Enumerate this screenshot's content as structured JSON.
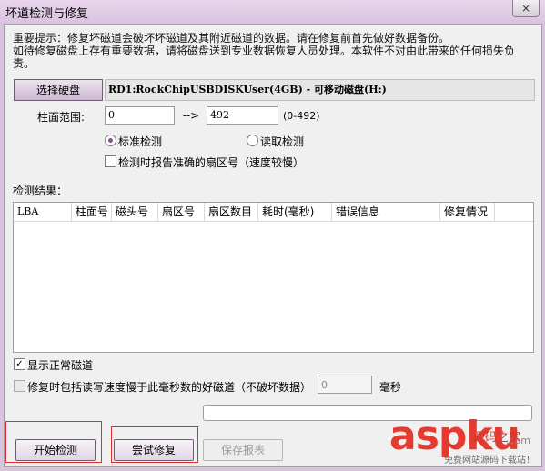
{
  "window": {
    "title": "坏道检测与修复",
    "close_label": "×"
  },
  "notice": {
    "line1": "重要提示：修复坏磁道会破坏坏磁道及其附近磁道的数据。请在修复前首先做好数据备份。",
    "line2": "如待修复磁盘上存有重要数据，请将磁盘送到专业数据恢复人员处理。本软件不对由此带来的任何损失负责。"
  },
  "disk": {
    "select_label": "选择硬盘",
    "name": "RD1:RockChipUSBDISKUser(4GB) - 可移动磁盘(H:)"
  },
  "cylinder": {
    "label": "柱面范围:",
    "start": "0",
    "arrow": "-->",
    "end": "492",
    "range_hint": "(0-492)"
  },
  "mode": {
    "standard": "标准检测",
    "read": "读取检测",
    "selected": "standard"
  },
  "report_sector": {
    "label": "检测时报告准确的扇区号（速度较慢）",
    "checked": false
  },
  "results": {
    "label": "检测结果：",
    "columns": [
      "LBA",
      "柱面号",
      "磁头号",
      "扇区号",
      "扇区数目",
      "耗时(毫秒)",
      "错误信息",
      "修复情况"
    ],
    "rows": []
  },
  "show_normal": {
    "label": "显示正常磁道",
    "checked": true
  },
  "repair_slow": {
    "label": "修复时包括读写速度慢于此毫秒数的好磁道（不破坏数据）",
    "checked": false,
    "value": "0",
    "unit": "毫秒"
  },
  "progress": {
    "value": 0
  },
  "buttons": {
    "start": "开始检测",
    "repair": "尝试修复",
    "save": "保存报表"
  },
  "watermark": {
    "brand": "aspku",
    "com": ".com",
    "sub": "源码之家",
    "foot": "免费网站源码下载站！"
  },
  "colors": {
    "accent": "#8f4f96",
    "highlight_box": "#d9322e",
    "watermark_red": "#e53a2f"
  }
}
